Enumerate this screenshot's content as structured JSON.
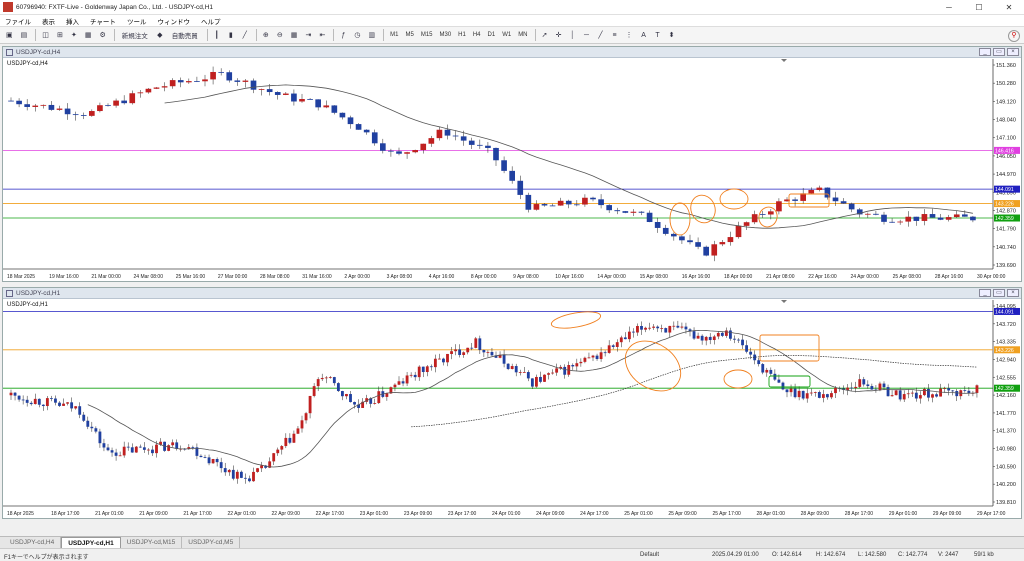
{
  "window": {
    "title": "60796940: FXTF-Live - Goldenway Japan Co., Ltd. - USDJPY-cd,H1"
  },
  "menu": [
    "ファイル",
    "表示",
    "挿入",
    "チャート",
    "ツール",
    "ウィンドウ",
    "ヘルプ"
  ],
  "toolbar": {
    "new_order": "新規注文",
    "auto_trade": "自動売買",
    "timeframes": [
      "M1",
      "M5",
      "M15",
      "M30",
      "H1",
      "H4",
      "D1",
      "W1",
      "MN"
    ]
  },
  "chart_top": {
    "window_title": "USDJPY-cd,H4",
    "symbol_label": "USDJPY-cd,H4",
    "price_ticks": [
      "151.360",
      "150.280",
      "149.120",
      "148.040",
      "147.100",
      "146.050",
      "144.970",
      "143.890",
      "142.870",
      "141.790",
      "140.740",
      "139.690"
    ],
    "time_ticks": [
      "18 Mar 2025",
      "19 Mar 16:00",
      "21 Mar 00:00",
      "24 Mar 08:00",
      "25 Mar 16:00",
      "27 Mar 00:00",
      "28 Mar 08:00",
      "31 Mar 16:00",
      "2 Apr 00:00",
      "3 Apr 08:00",
      "4 Apr 16:00",
      "8 Apr 00:00",
      "9 Apr 08:00",
      "10 Apr 16:00",
      "14 Apr 00:00",
      "15 Apr 08:00",
      "16 Apr 16:00",
      "18 Apr 00:00",
      "21 Apr 08:00",
      "22 Apr 16:00",
      "24 Apr 00:00",
      "25 Apr 08:00",
      "28 Apr 16:00",
      "30 Apr 00:00"
    ],
    "hlines": [
      {
        "price": "146.416",
        "color": "#e040e0"
      },
      {
        "price": "144.091",
        "color": "#2020c0"
      },
      {
        "price": "143.226",
        "color": "#f0a020"
      },
      {
        "price": "142.359",
        "color": "#10a010"
      }
    ]
  },
  "chart_bottom": {
    "window_title": "USDJPY-cd,H1",
    "symbol_label": "USDJPY-cd,H1",
    "price_ticks": [
      "144.095",
      "143.720",
      "143.335",
      "142.940",
      "142.555",
      "142.160",
      "141.770",
      "141.370",
      "140.980",
      "140.590",
      "140.200",
      "139.810"
    ],
    "time_ticks": [
      "18 Apr 2025",
      "18 Apr 17:00",
      "21 Apr 01:00",
      "21 Apr 09:00",
      "21 Apr 17:00",
      "22 Apr 01:00",
      "22 Apr 09:00",
      "22 Apr 17:00",
      "23 Apr 01:00",
      "23 Apr 09:00",
      "23 Apr 17:00",
      "24 Apr 01:00",
      "24 Apr 09:00",
      "24 Apr 17:00",
      "25 Apr 01:00",
      "25 Apr 09:00",
      "25 Apr 17:00",
      "28 Apr 01:00",
      "28 Apr 09:00",
      "28 Apr 17:00",
      "29 Apr 01:00",
      "29 Apr 09:00",
      "29 Apr 17:00"
    ],
    "hlines": [
      {
        "price": "144.091",
        "color": "#2020c0"
      },
      {
        "price": "143.226",
        "color": "#f0a020"
      },
      {
        "price": "142.359",
        "color": "#10a010"
      }
    ]
  },
  "tabs": [
    "USDJPY-cd,H4",
    "USDJPY-cd,H1",
    "USDJPY-cd,M15",
    "USDJPY-cd,M5"
  ],
  "active_tab": 1,
  "status": {
    "help": "F1キーでヘルプが表示されます",
    "profile": "Default",
    "datetime": "2025.04.29 01:00",
    "open": "O: 142.614",
    "high": "H: 142.674",
    "low": "L: 142.580",
    "close": "C: 142.774",
    "volume": "V: 2447",
    "traffic": "59/1 kb"
  },
  "colors": {
    "bull": "#c02020",
    "bear": "#2040a0",
    "ma": "#555555",
    "highlight": "#f08020"
  }
}
